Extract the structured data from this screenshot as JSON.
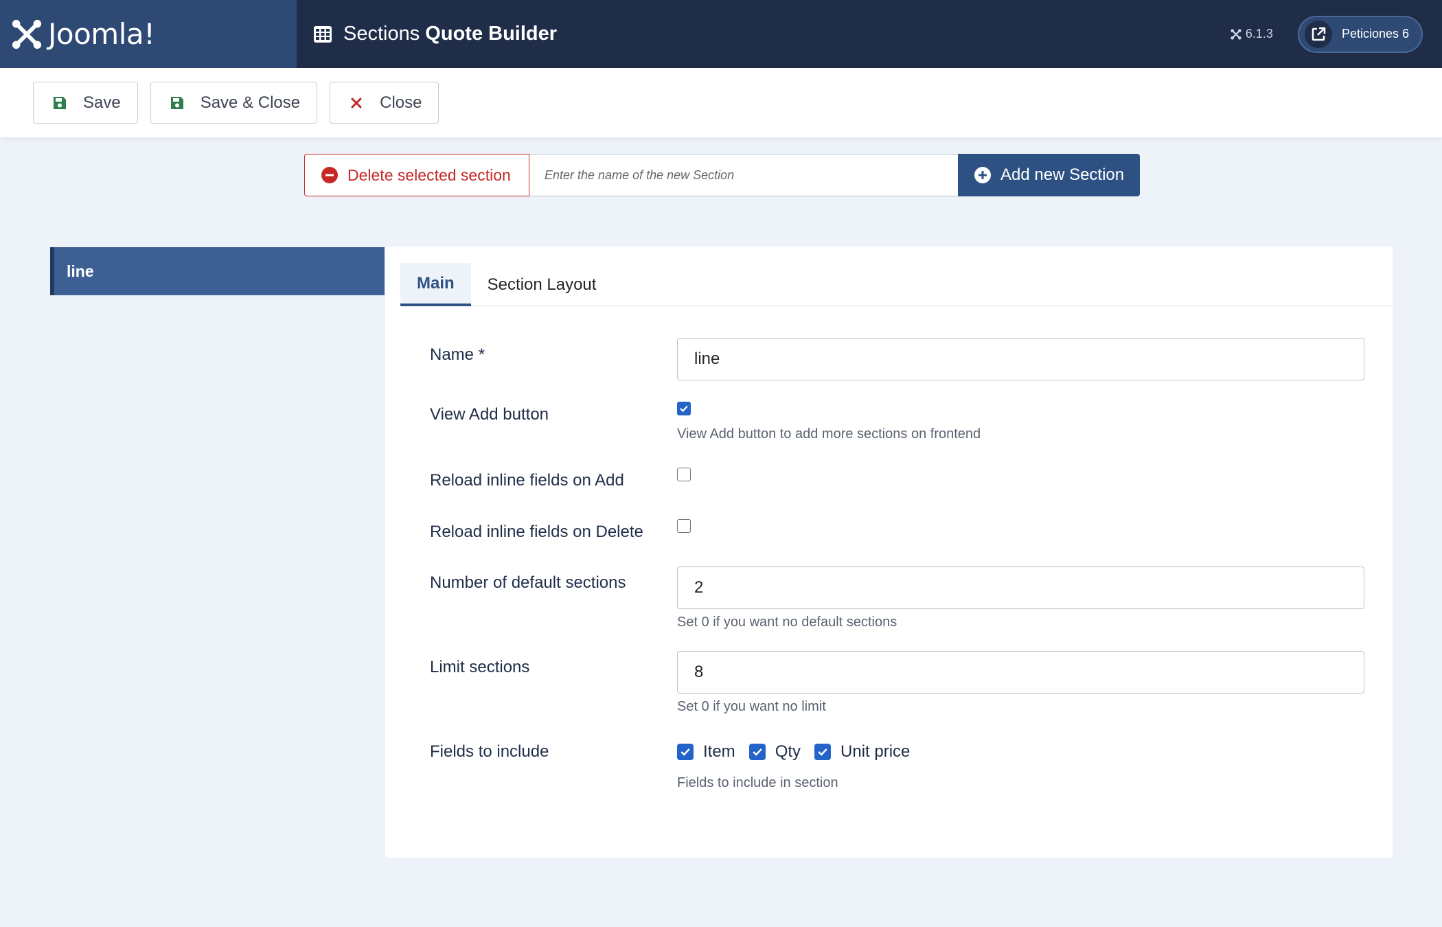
{
  "header": {
    "logo_text": "Joomla!",
    "title_light": "Sections",
    "title_bold": "Quote Builder",
    "version": "6.1.3",
    "requests_label": "Peticiones 6"
  },
  "toolbar": {
    "save_label": "Save",
    "save_close_label": "Save & Close",
    "close_label": "Close"
  },
  "section_bar": {
    "delete_label": "Delete selected section",
    "new_placeholder": "Enter the name of the new Section",
    "add_label": "Add new Section"
  },
  "sidebar": {
    "items": [
      {
        "label": "line"
      }
    ]
  },
  "tabs": [
    {
      "label": "Main"
    },
    {
      "label": "Section Layout"
    }
  ],
  "form": {
    "name_label": "Name *",
    "name_value": "line",
    "view_add_label": "View Add button",
    "view_add_checked": true,
    "view_add_help": "View Add button to add more sections on frontend",
    "reload_add_label": "Reload inline fields on Add",
    "reload_add_checked": false,
    "reload_delete_label": "Reload inline fields on Delete",
    "reload_delete_checked": false,
    "default_sections_label": "Number of default sections",
    "default_sections_value": "2",
    "default_sections_help": "Set 0 if you want no default sections",
    "limit_label": "Limit sections",
    "limit_value": "8",
    "limit_help": "Set 0 if you want no limit",
    "fields_label": "Fields to include",
    "fields": [
      {
        "label": "Item",
        "checked": true
      },
      {
        "label": "Qty",
        "checked": true
      },
      {
        "label": "Unit price",
        "checked": true
      }
    ],
    "fields_help": "Fields to include in section"
  },
  "colors": {
    "header_bg": "#1f2d48",
    "logo_bg": "#2e4a74",
    "primary": "#2e5183",
    "danger": "#c52827",
    "save_icon": "#2f7d4a",
    "checkbox": "#2463c8"
  },
  "icons": {
    "logo": "joomla-logo-icon",
    "title": "table-grid-icon",
    "version": "joomla-small-icon",
    "requests": "external-link-icon",
    "save": "floppy-disk-icon",
    "close": "close-x-icon",
    "delete": "minus-circle-icon",
    "add": "plus-circle-icon"
  }
}
